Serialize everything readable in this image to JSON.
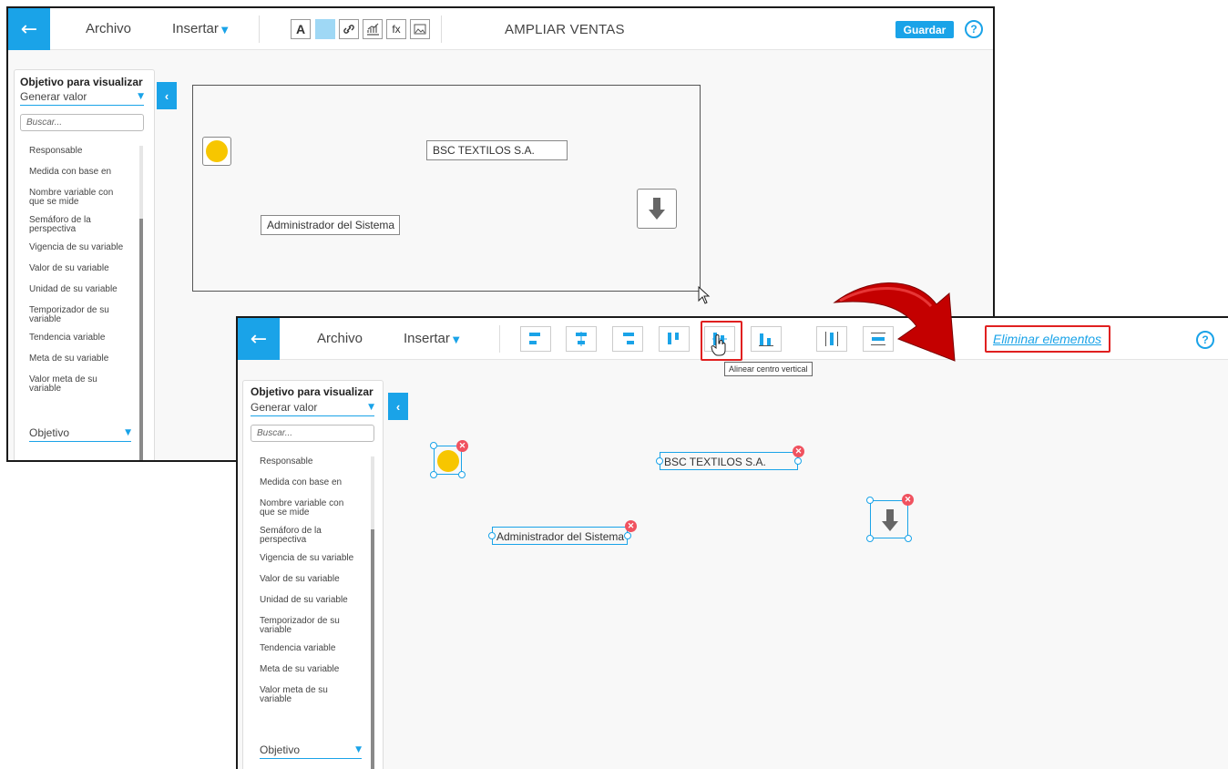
{
  "before": {
    "back_arrow": "←",
    "menu": {
      "file": "Archivo",
      "insert": "Insertar"
    },
    "format_tools": {
      "text": "A",
      "fx": "fx"
    },
    "title": "AMPLIAR VENTAS",
    "save": "Guardar",
    "help": "?",
    "panel": {
      "title": "Objetivo para visualizar",
      "select": "Generar valor",
      "search_placeholder": "Buscar...",
      "items": [
        "Responsable",
        "Medida con base en",
        "Nombre variable con\nque se mide",
        "Semáforo de la\nperspectiva",
        "Vigencia de su variable",
        "Valor de su variable",
        "Unidad de su variable",
        "Temporizador de su\nvariable",
        "Tendencia variable",
        "Meta de su variable",
        "Valor meta de su\nvariable"
      ],
      "bottom_select": "Objetivo"
    },
    "collapse": "‹",
    "canvas": {
      "company": "BSC TEXTILOS S.A.",
      "admin": "Administrador del Sistema"
    }
  },
  "after": {
    "back_arrow": "←",
    "menu": {
      "file": "Archivo",
      "insert": "Insertar"
    },
    "delete_elements": "Eliminar elementos",
    "tooltip": "Alinear centro vertical",
    "help": "?",
    "panel": {
      "title": "Objetivo para visualizar",
      "select": "Generar valor",
      "search_placeholder": "Buscar...",
      "items": [
        "Responsable",
        "Medida con base en",
        "Nombre variable con\nque se mide",
        "Semáforo de la\nperspectiva",
        "Vigencia de su variable",
        "Valor de su variable",
        "Unidad de su variable",
        "Temporizador de su\nvariable",
        "Tendencia variable",
        "Meta de su variable",
        "Valor meta de su\nvariable"
      ],
      "bottom_select": "Objetivo"
    },
    "collapse": "‹",
    "canvas": {
      "company": "BSC TEXTILOS S.A.",
      "admin": "Administrador del Sistema"
    },
    "remove_mark": "✕"
  },
  "colors": {
    "accent": "#1aa3e8",
    "highlight": "#e02020",
    "semaphore": "#f7c600",
    "remove": "#f0525f"
  }
}
